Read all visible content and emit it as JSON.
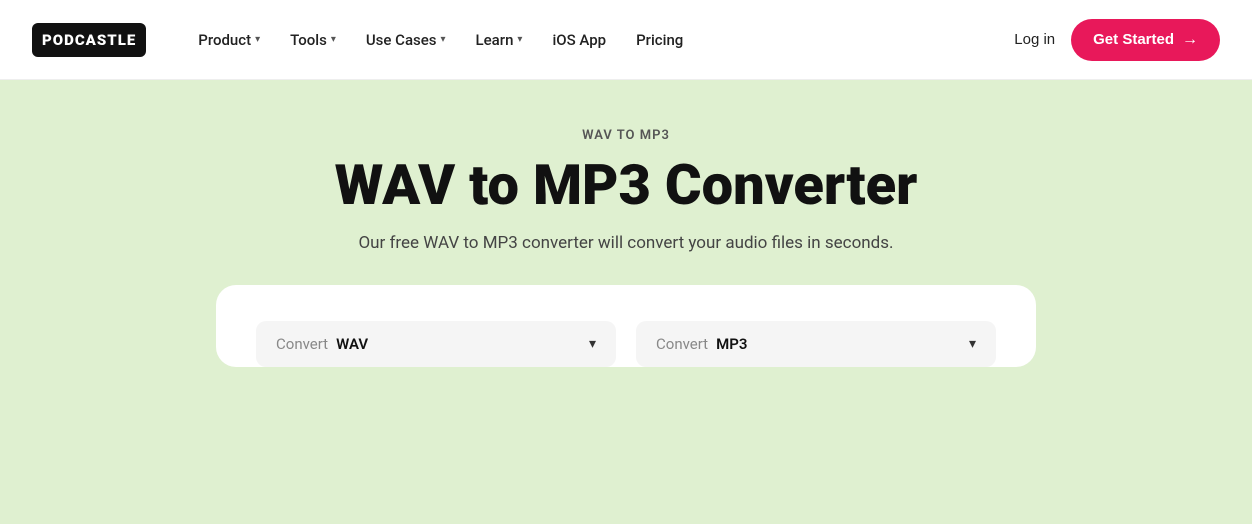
{
  "header": {
    "logo_text": "PODCASTLE",
    "nav_items": [
      {
        "label": "Product",
        "has_dropdown": true
      },
      {
        "label": "Tools",
        "has_dropdown": true
      },
      {
        "label": "Use Cases",
        "has_dropdown": true
      },
      {
        "label": "Learn",
        "has_dropdown": true
      },
      {
        "label": "iOS App",
        "has_dropdown": false
      },
      {
        "label": "Pricing",
        "has_dropdown": false
      }
    ],
    "login_label": "Log in",
    "get_started_label": "Get Started"
  },
  "main": {
    "subtitle": "WAV TO MP3",
    "title": "WAV to MP3 Converter",
    "description": "Our free WAV to MP3 converter will convert your audio files in seconds.",
    "from_dropdown": {
      "prefix": "Convert",
      "value": "WAV"
    },
    "to_dropdown": {
      "prefix": "Convert",
      "value": "MP3"
    }
  }
}
